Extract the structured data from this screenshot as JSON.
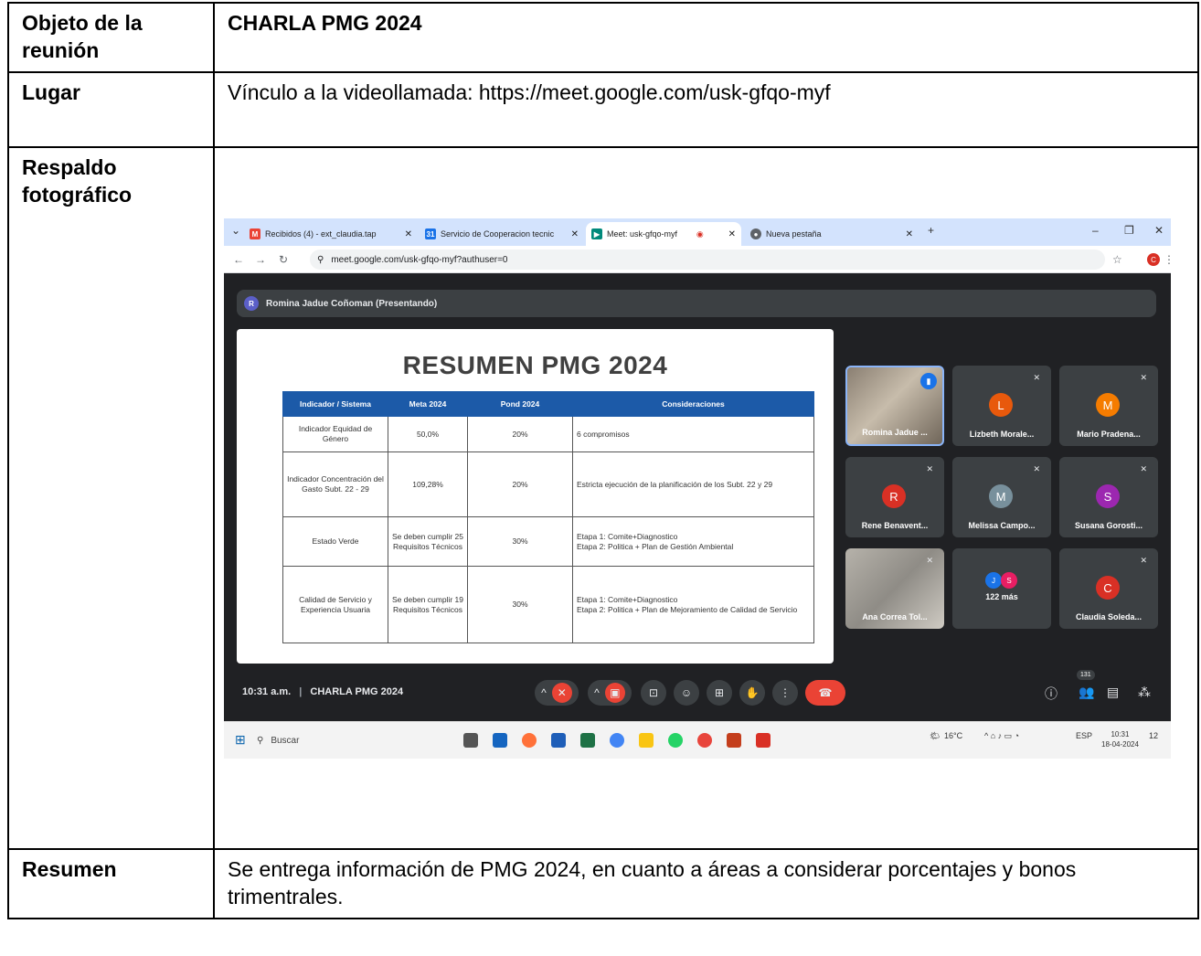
{
  "objeto": {
    "label": "Objeto de la reunión",
    "value": "CHARLA PMG 2024"
  },
  "lugar": {
    "label": "Lugar",
    "value": "Vínculo a la videollamada: https://meet.google.com/usk-gfqo-myf"
  },
  "respaldo": {
    "label": "Respaldo fotográfico"
  },
  "resumen": {
    "label": "Resumen",
    "value": "Se entrega información de PMG 2024, en cuanto a áreas a considerar porcentajes y bonos trimentrales."
  },
  "screenshot": {
    "tabs": [
      "Recibidos (4) - ext_claudia.tap",
      "Servicio de Cooperacion tecnic",
      "Meet: usk-gfqo-myf",
      "Nueva pestaña"
    ],
    "url": "meet.google.com/usk-gfqo-myf?authuser=0",
    "presenter": "Romina Jadue Coñoman (Presentando)",
    "presenter_initial": "R",
    "slide": {
      "title": "RESUMEN PMG 2024",
      "headers": [
        "Indicador / Sistema",
        "Meta 2024",
        "Pond 2024",
        "Consideraciones"
      ],
      "rows": [
        {
          "indicador": "Indicador Equidad de Género",
          "meta": "50,0%",
          "pond": "20%",
          "consideraciones": "6 compromisos"
        },
        {
          "indicador": "Indicador Concentración del Gasto Subt. 22 - 29",
          "meta": "109,28%",
          "pond": "20%",
          "consideraciones": "Estricta ejecución de la planificación de los Subt. 22 y 29"
        },
        {
          "indicador": "Estado Verde",
          "meta": "Se deben cumplir 25 Requisitos Técnicos",
          "pond": "30%",
          "consideraciones": "Etapa 1: Comite+Diagnostico\nEtapa 2: Politica + Plan de Gestión Ambiental"
        },
        {
          "indicador": "Calidad de Servicio y Experiencia Usuaria",
          "meta": "Se deben cumplir 19 Requisitos Técnicos",
          "pond": "30%",
          "consideraciones": "Etapa 1: Comite+Diagnostico\nEtapa 2: Politica + Plan de Mejoramiento de Calidad de Servicio"
        }
      ]
    },
    "participants": [
      {
        "name": "Romina Jadue ...",
        "initial": "",
        "color": ""
      },
      {
        "name": "Lizbeth Morale...",
        "initial": "L",
        "color": "#e8590c"
      },
      {
        "name": "Mario Pradena...",
        "initial": "M",
        "color": "#f57c00"
      },
      {
        "name": "Rene Benavent...",
        "initial": "R",
        "color": "#d93025"
      },
      {
        "name": "Melissa Campo...",
        "initial": "M",
        "color": "#78909c"
      },
      {
        "name": "Susana Gorosti...",
        "initial": "S",
        "color": "#9c27b0"
      },
      {
        "name": "Ana Correa Tol...",
        "initial": "",
        "color": ""
      },
      {
        "name": "122 más",
        "initial": "",
        "color": ""
      },
      {
        "name": "Claudia Soleda...",
        "initial": "C",
        "color": "#d93025"
      }
    ],
    "more_initials": [
      "J",
      "S"
    ],
    "time": "10:31 a.m.",
    "meeting_name": "CHARLA PMG 2024",
    "people_count": "131",
    "taskbar": {
      "search": "Buscar",
      "temp": "16°C",
      "lang": "ESP",
      "clock_time": "10:31",
      "clock_date": "18-04-2024",
      "notif": "12"
    }
  }
}
